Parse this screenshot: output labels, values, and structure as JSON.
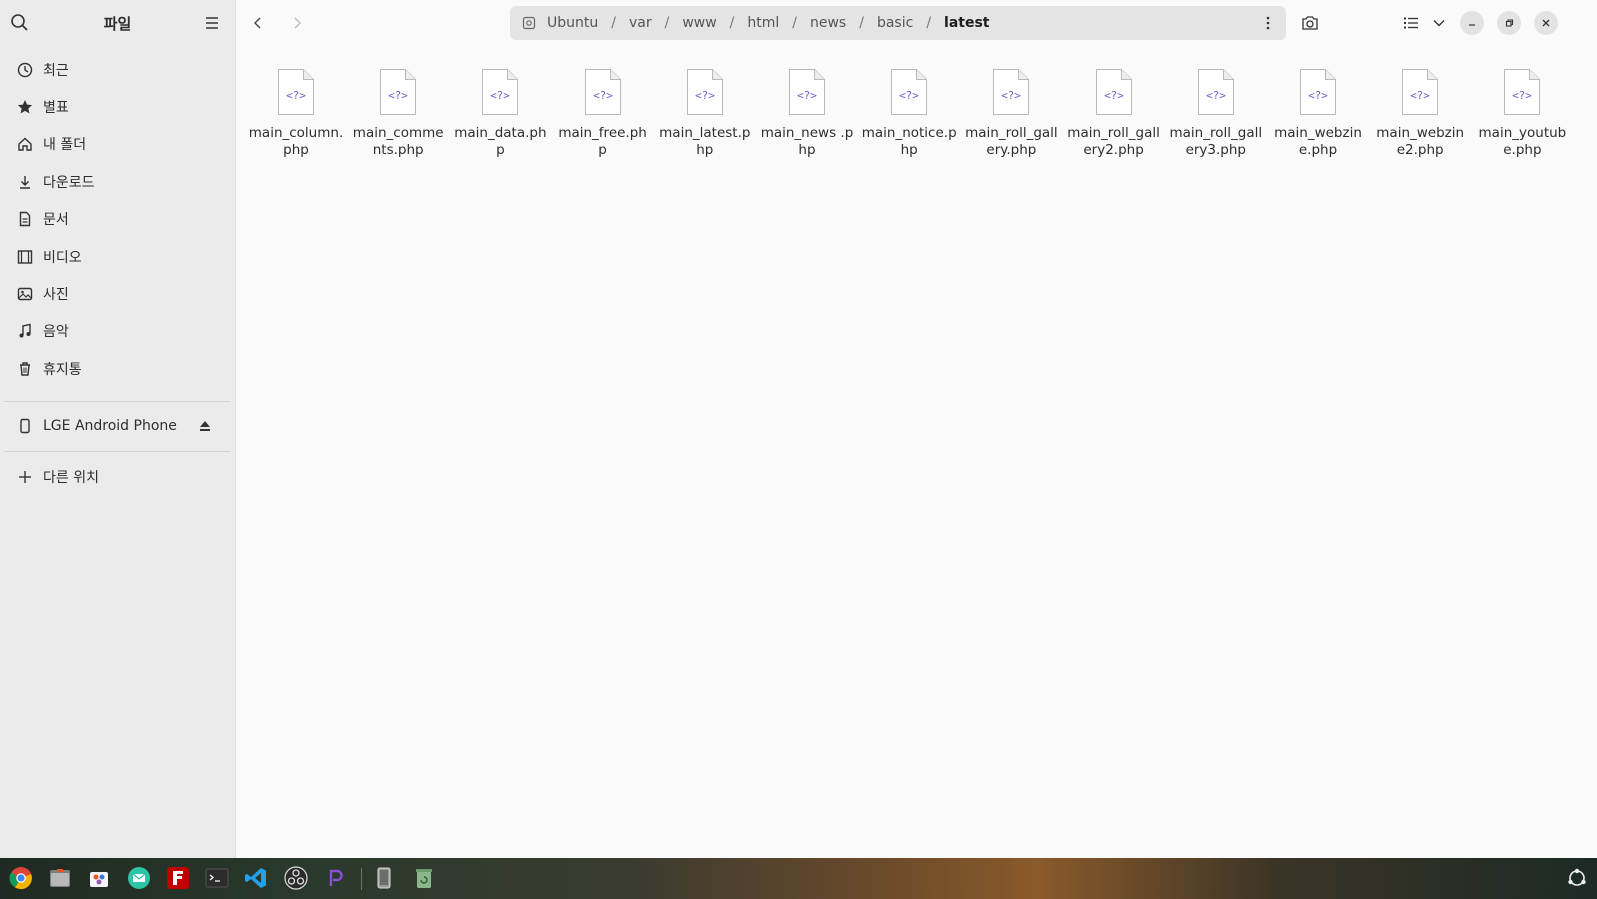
{
  "sidebar": {
    "title": "파일",
    "items": [
      {
        "label": "최근",
        "icon": "clock-icon"
      },
      {
        "label": "별표",
        "icon": "star-icon"
      },
      {
        "label": "내 폴더",
        "icon": "home-icon"
      },
      {
        "label": "다운로드",
        "icon": "download-icon"
      },
      {
        "label": "문서",
        "icon": "document-icon"
      },
      {
        "label": "비디오",
        "icon": "video-icon"
      },
      {
        "label": "사진",
        "icon": "picture-icon"
      },
      {
        "label": "음악",
        "icon": "music-icon"
      },
      {
        "label": "휴지통",
        "icon": "trash-icon"
      }
    ],
    "device": {
      "label": "LGE Android Phone",
      "icon": "phone-icon"
    },
    "other_locations": {
      "label": "다른 위치",
      "icon": "plus-icon"
    }
  },
  "pathbar": {
    "segments": [
      "Ubuntu",
      "var",
      "www",
      "html",
      "news",
      "basic",
      "latest"
    ]
  },
  "files": [
    {
      "name": "main_column.php"
    },
    {
      "name": "main_comments.php"
    },
    {
      "name": "main_data.php"
    },
    {
      "name": "main_free.php"
    },
    {
      "name": "main_latest.php"
    },
    {
      "name": "main_news .php"
    },
    {
      "name": "main_notice.php"
    },
    {
      "name": "main_roll_gallery.php"
    },
    {
      "name": "main_roll_gallery2.php"
    },
    {
      "name": "main_roll_gallery3.php"
    },
    {
      "name": "main_webzine.php"
    },
    {
      "name": "main_webzine2.php"
    },
    {
      "name": "main_youtube.php"
    }
  ],
  "file_icon_glyph": "<?>",
  "colors": {
    "accent": "#6b5fd3",
    "sidebar_bg": "#ebebeb",
    "content_bg": "#fafafa"
  },
  "dock": [
    {
      "name": "chrome-icon"
    },
    {
      "name": "files-icon"
    },
    {
      "name": "software-center-icon"
    },
    {
      "name": "mail-icon"
    },
    {
      "name": "filezilla-icon"
    },
    {
      "name": "terminal-icon"
    },
    {
      "name": "vscode-icon"
    },
    {
      "name": "obs-icon"
    },
    {
      "name": "app-icon"
    },
    {
      "name": "phone-device-icon"
    },
    {
      "name": "recycle-bin-icon"
    }
  ]
}
